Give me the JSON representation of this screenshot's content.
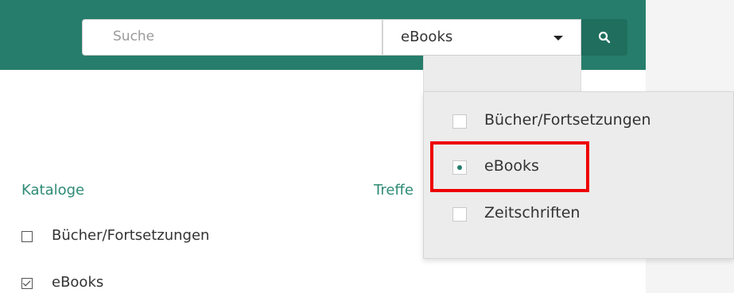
{
  "search": {
    "placeholder": "Suche"
  },
  "category_select": {
    "selected": "eBooks"
  },
  "dropdown": {
    "options": [
      {
        "label": "Bücher/Fortsetzungen",
        "selected": false
      },
      {
        "label": "eBooks",
        "selected": true
      },
      {
        "label": "Zeitschriften",
        "selected": false
      }
    ]
  },
  "sidebar": {
    "title": "Kataloge",
    "items": [
      {
        "label": "Bücher/Fortsetzungen",
        "checked": false
      },
      {
        "label": "eBooks",
        "checked": true
      }
    ]
  },
  "results": {
    "title_partial": "Treffe"
  },
  "colors": {
    "header": "#267d6b",
    "accent": "#2e8b76",
    "highlight": "#ee0000"
  },
  "icons": {
    "search_button": "search-icon",
    "select_caret": "chevron-down-icon"
  }
}
